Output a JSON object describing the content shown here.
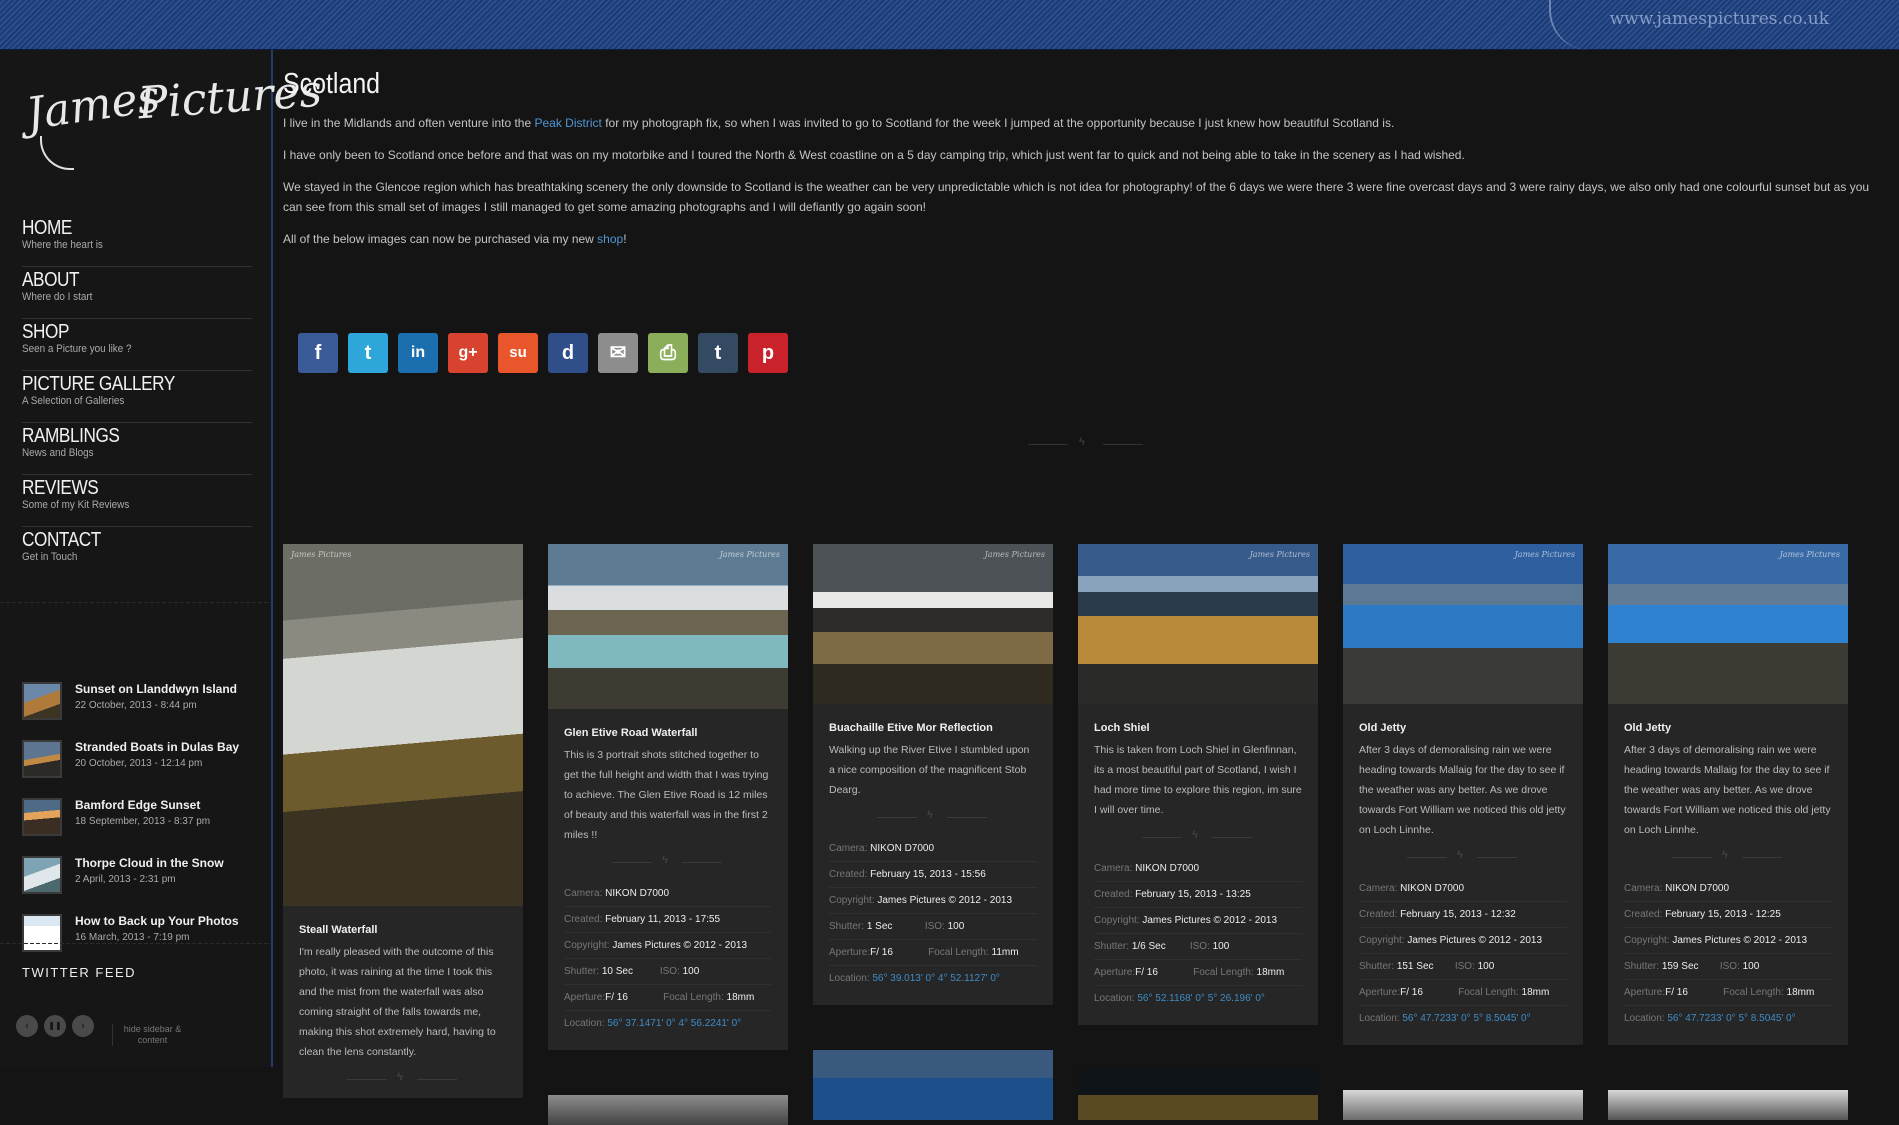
{
  "header": {
    "url_text": "www.jamespictures.co.uk"
  },
  "logo": {
    "line1": "James",
    "line2": "Pictures"
  },
  "nav": [
    {
      "title": "HOME",
      "subtitle": "Where the heart is"
    },
    {
      "title": "ABOUT",
      "subtitle": "Where do I start"
    },
    {
      "title": "SHOP",
      "subtitle": "Seen a Picture you like ?"
    },
    {
      "title": "PICTURE GALLERY",
      "subtitle": "A Selection of Galleries"
    },
    {
      "title": "RAMBLINGS",
      "subtitle": "News and Blogs"
    },
    {
      "title": "REVIEWS",
      "subtitle": "Some of my Kit Reviews"
    },
    {
      "title": "CONTACT",
      "subtitle": "Get in Touch"
    }
  ],
  "recent_posts": [
    {
      "title": "Sunset on Llanddwyn Island",
      "date": "22 October, 2013 - 8:44 pm"
    },
    {
      "title": "Stranded Boats in Dulas Bay",
      "date": "20 October, 2013 - 12:14 pm"
    },
    {
      "title": "Bamford Edge Sunset",
      "date": "18 September, 2013 - 8:37 pm"
    },
    {
      "title": "Thorpe Cloud in the Snow",
      "date": "2 April, 2013 - 2:31 pm"
    },
    {
      "title": "How to Back up Your Photos",
      "date": "16 March, 2013 - 7:19 pm"
    }
  ],
  "twitter_title": "TWITTER FEED",
  "slider_controls": {
    "prev": "‹",
    "pause": "❚❚",
    "next": "›",
    "hide_label": "hide sidebar & content"
  },
  "page": {
    "title": "Scotland",
    "p1_before": "I live in the Midlands and often venture into the ",
    "p1_link": "Peak District",
    "p1_after": " for my photograph fix, so when I was invited to go to Scotland for the week I jumped at the opportunity because I just knew how beautiful Scotland is.",
    "p2": "I have only been to Scotland once before and that was on my motorbike and I toured the North & West coastline on a 5 day camping trip, which just went far to quick and not being able to take in the scenery as I had wished.",
    "p3": "We stayed in the Glencoe region which has breathtaking scenery the only downside to Scotland is the weather can be very unpredictable which is not idea for photography! of the 6 days we were there 3 were fine overcast days and 3 were rainy days, we also only had one colourful sunset but as you can see from this small set of images I still managed to get some amazing photographs and I will defiantly go again soon!",
    "p4_before": "All of the below images can now be purchased via my new ",
    "p4_link": "shop",
    "p4_after": "!"
  },
  "share_buttons": [
    {
      "name": "facebook",
      "glyph": "f",
      "color": "#3b5b98"
    },
    {
      "name": "twitter",
      "glyph": "t",
      "color": "#2fa6d9"
    },
    {
      "name": "linkedin",
      "glyph": "in",
      "color": "#1c6fae"
    },
    {
      "name": "googleplus",
      "glyph": "g+",
      "color": "#d8432f"
    },
    {
      "name": "stumbleupon",
      "glyph": "su",
      "color": "#e9562b"
    },
    {
      "name": "delicious",
      "glyph": "d",
      "color": "#2f4e8a"
    },
    {
      "name": "email",
      "glyph": "✉",
      "color": "#8d8d8d"
    },
    {
      "name": "print",
      "glyph": "⎙",
      "color": "#8aae5a"
    },
    {
      "name": "tumblr",
      "glyph": "t",
      "color": "#344a63"
    },
    {
      "name": "pinterest",
      "glyph": "p",
      "color": "#c9222a"
    }
  ],
  "labels": {
    "camera": "Camera:",
    "created": "Created:",
    "copyright": "Copyright:",
    "shutter": "Shutter:",
    "iso": "ISO:",
    "aperture": "Aperture:",
    "focal": "Focal Length:",
    "location": "Location:"
  },
  "cards": [
    {
      "title": "Steall Waterfall",
      "desc": "I'm really pleased with the outcome of this photo, it was raining at the time I took this and the mist from the waterfall was also coming straight of the falls towards me, making this shot extremely hard, having to clean the lens constantly."
    },
    {
      "title": "Glen Etive Road Waterfall",
      "desc": "This is 3 portrait shots stitched together to get the full height and width that I was trying to achieve. The Glen Etive Road is 12 miles of beauty and this waterfall was in the first 2 miles !!",
      "camera": "NIKON D7000",
      "created": "February 11, 2013 - 17:55",
      "copyright": "James Pictures © 2012 - 2013",
      "shutter": "10 Sec",
      "iso": "100",
      "aperture": "F/ 16",
      "focal": "18mm",
      "location": "56° 37.1471' 0° 4° 56.2241' 0°"
    },
    {
      "title": "Buachaille Etive Mor Reflection",
      "desc": "Walking up the River Etive I stumbled upon a nice composition of the magnificent Stob Dearg.",
      "camera": "NIKON D7000",
      "created": "February 15, 2013 - 15:56",
      "copyright": "James Pictures © 2012 - 2013",
      "shutter": "1 Sec",
      "iso": "100",
      "aperture": "F/ 16",
      "focal": "11mm",
      "location": "56° 39.013' 0° 4° 52.1127' 0°"
    },
    {
      "title": "Loch Shiel",
      "desc": "This is taken from Loch Shiel in Glenfinnan, its a most beautiful part of Scotland, I wish I had more time to explore this region, im sure I will over time.",
      "camera": "NIKON D7000",
      "created": "February 15, 2013 - 13:25",
      "copyright": "James Pictures © 2012 - 2013",
      "shutter": "1/6 Sec",
      "iso": "100",
      "aperture": "F/ 16",
      "focal": "18mm",
      "location": "56° 52.1168' 0° 5° 26.196' 0°"
    },
    {
      "title": "Old Jetty",
      "desc": "After 3 days of demoralising rain we were heading towards Mallaig for the day to see if the weather was any better. As we drove towards Fort William we noticed this old jetty on Loch Linnhe.",
      "camera": "NIKON D7000",
      "created": "February 15, 2013 - 12:32",
      "copyright": "James Pictures © 2012 - 2013",
      "shutter": "151 Sec",
      "iso": "100",
      "aperture": "F/ 16",
      "focal": "18mm",
      "location": "56° 47.7233' 0° 5° 8.5045' 0°"
    },
    {
      "title": "Old Jetty",
      "desc": "After 3 days of demoralising rain we were heading towards Mallaig for the day to see if the weather was any better. As we drove towards Fort William we noticed this old jetty on Loch Linnhe.",
      "camera": "NIKON D7000",
      "created": "February 15, 2013 - 12:25",
      "copyright": "James Pictures © 2012 - 2013",
      "shutter": "159 Sec",
      "iso": "100",
      "aperture": "F/ 16",
      "focal": "18mm",
      "location": "56° 47.7233' 0° 5° 8.5045' 0°"
    }
  ],
  "watermark": "James Pictures"
}
